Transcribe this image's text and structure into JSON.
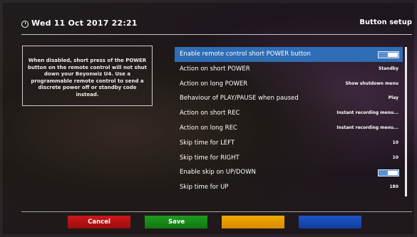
{
  "header": {
    "datetime": "Wed 11 Oct 2017  22:21",
    "title": "Button setup"
  },
  "help": {
    "text": "When disabled, short press of the POWER button on the remote control will not shut down your Beyonwiz U4. Use a programmable remote control to send a discrete power off or standby code instead."
  },
  "settings": [
    {
      "label": "Enable remote control short POWER button",
      "type": "toggle",
      "on": true,
      "selected": true
    },
    {
      "label": "Action on short POWER",
      "value": "Standby"
    },
    {
      "label": "Action on long POWER",
      "value": "Show shutdown menu"
    },
    {
      "label": "Behaviour of PLAY/PAUSE when paused",
      "value": "Play"
    },
    {
      "label": "Action on short REC",
      "value": "Instant recording menu..."
    },
    {
      "label": "Action on long REC",
      "value": "Instant recording menu..."
    },
    {
      "label": "Skip time for LEFT",
      "value": "10"
    },
    {
      "label": "Skip time for RIGHT",
      "value": "10"
    },
    {
      "label": "Enable skip on UP/DOWN",
      "type": "toggle",
      "on": true
    },
    {
      "label": "Skip time for UP",
      "value": "180"
    }
  ],
  "color_keys": {
    "red": "Cancel",
    "green": "Save",
    "yellow": "",
    "blue": ""
  },
  "colors": {
    "selection": "#2f6db5",
    "red": "#cc1818",
    "green": "#1f9a1f",
    "yellow": "#f0a800",
    "blue": "#1d56c8"
  }
}
